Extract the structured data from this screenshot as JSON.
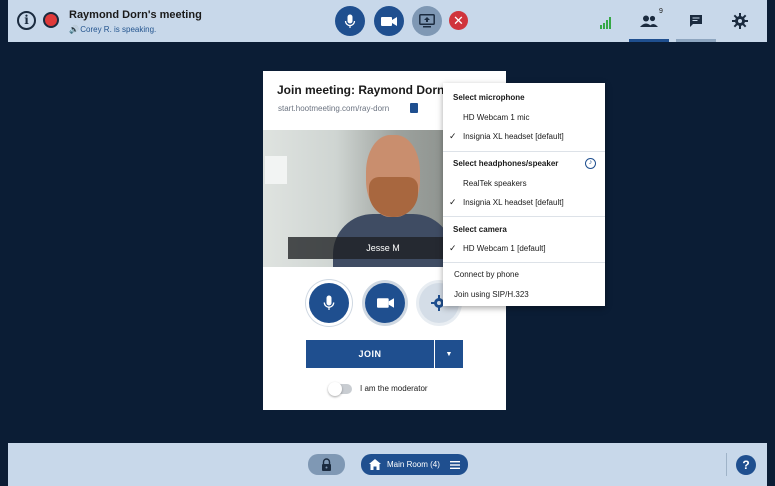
{
  "header": {
    "meeting_title": "Raymond Dorn's meeting",
    "speaking": "Corey R. is speaking.",
    "participants_count": "9"
  },
  "join_card": {
    "title": "Join meeting: Raymond Dorn",
    "url": "start.hootmeeting.com/ray-dorn",
    "video_name": "Jesse M",
    "join_label": "JOIN",
    "moderator_label": "I am the moderator"
  },
  "device_menu": {
    "mic_heading": "Select microphone",
    "mic_options": [
      "HD Webcam 1 mic",
      "Insignia XL headset [default]"
    ],
    "speaker_heading": "Select headphones/speaker",
    "speaker_options": [
      "RealTek speakers",
      "Insignia XL headset [default]"
    ],
    "camera_heading": "Select camera",
    "camera_options": [
      "HD Webcam 1 [default]"
    ],
    "connect_phone": "Connect by phone",
    "join_sip": "Join using SIP/H.323"
  },
  "footer": {
    "room_label": "Main Room (4)"
  },
  "colors": {
    "stage_bg": "#0b1d35",
    "bar_bg": "#c8d8ea",
    "primary": "#1f4f8f",
    "end_call": "#d0343c",
    "signal": "#35a845"
  }
}
